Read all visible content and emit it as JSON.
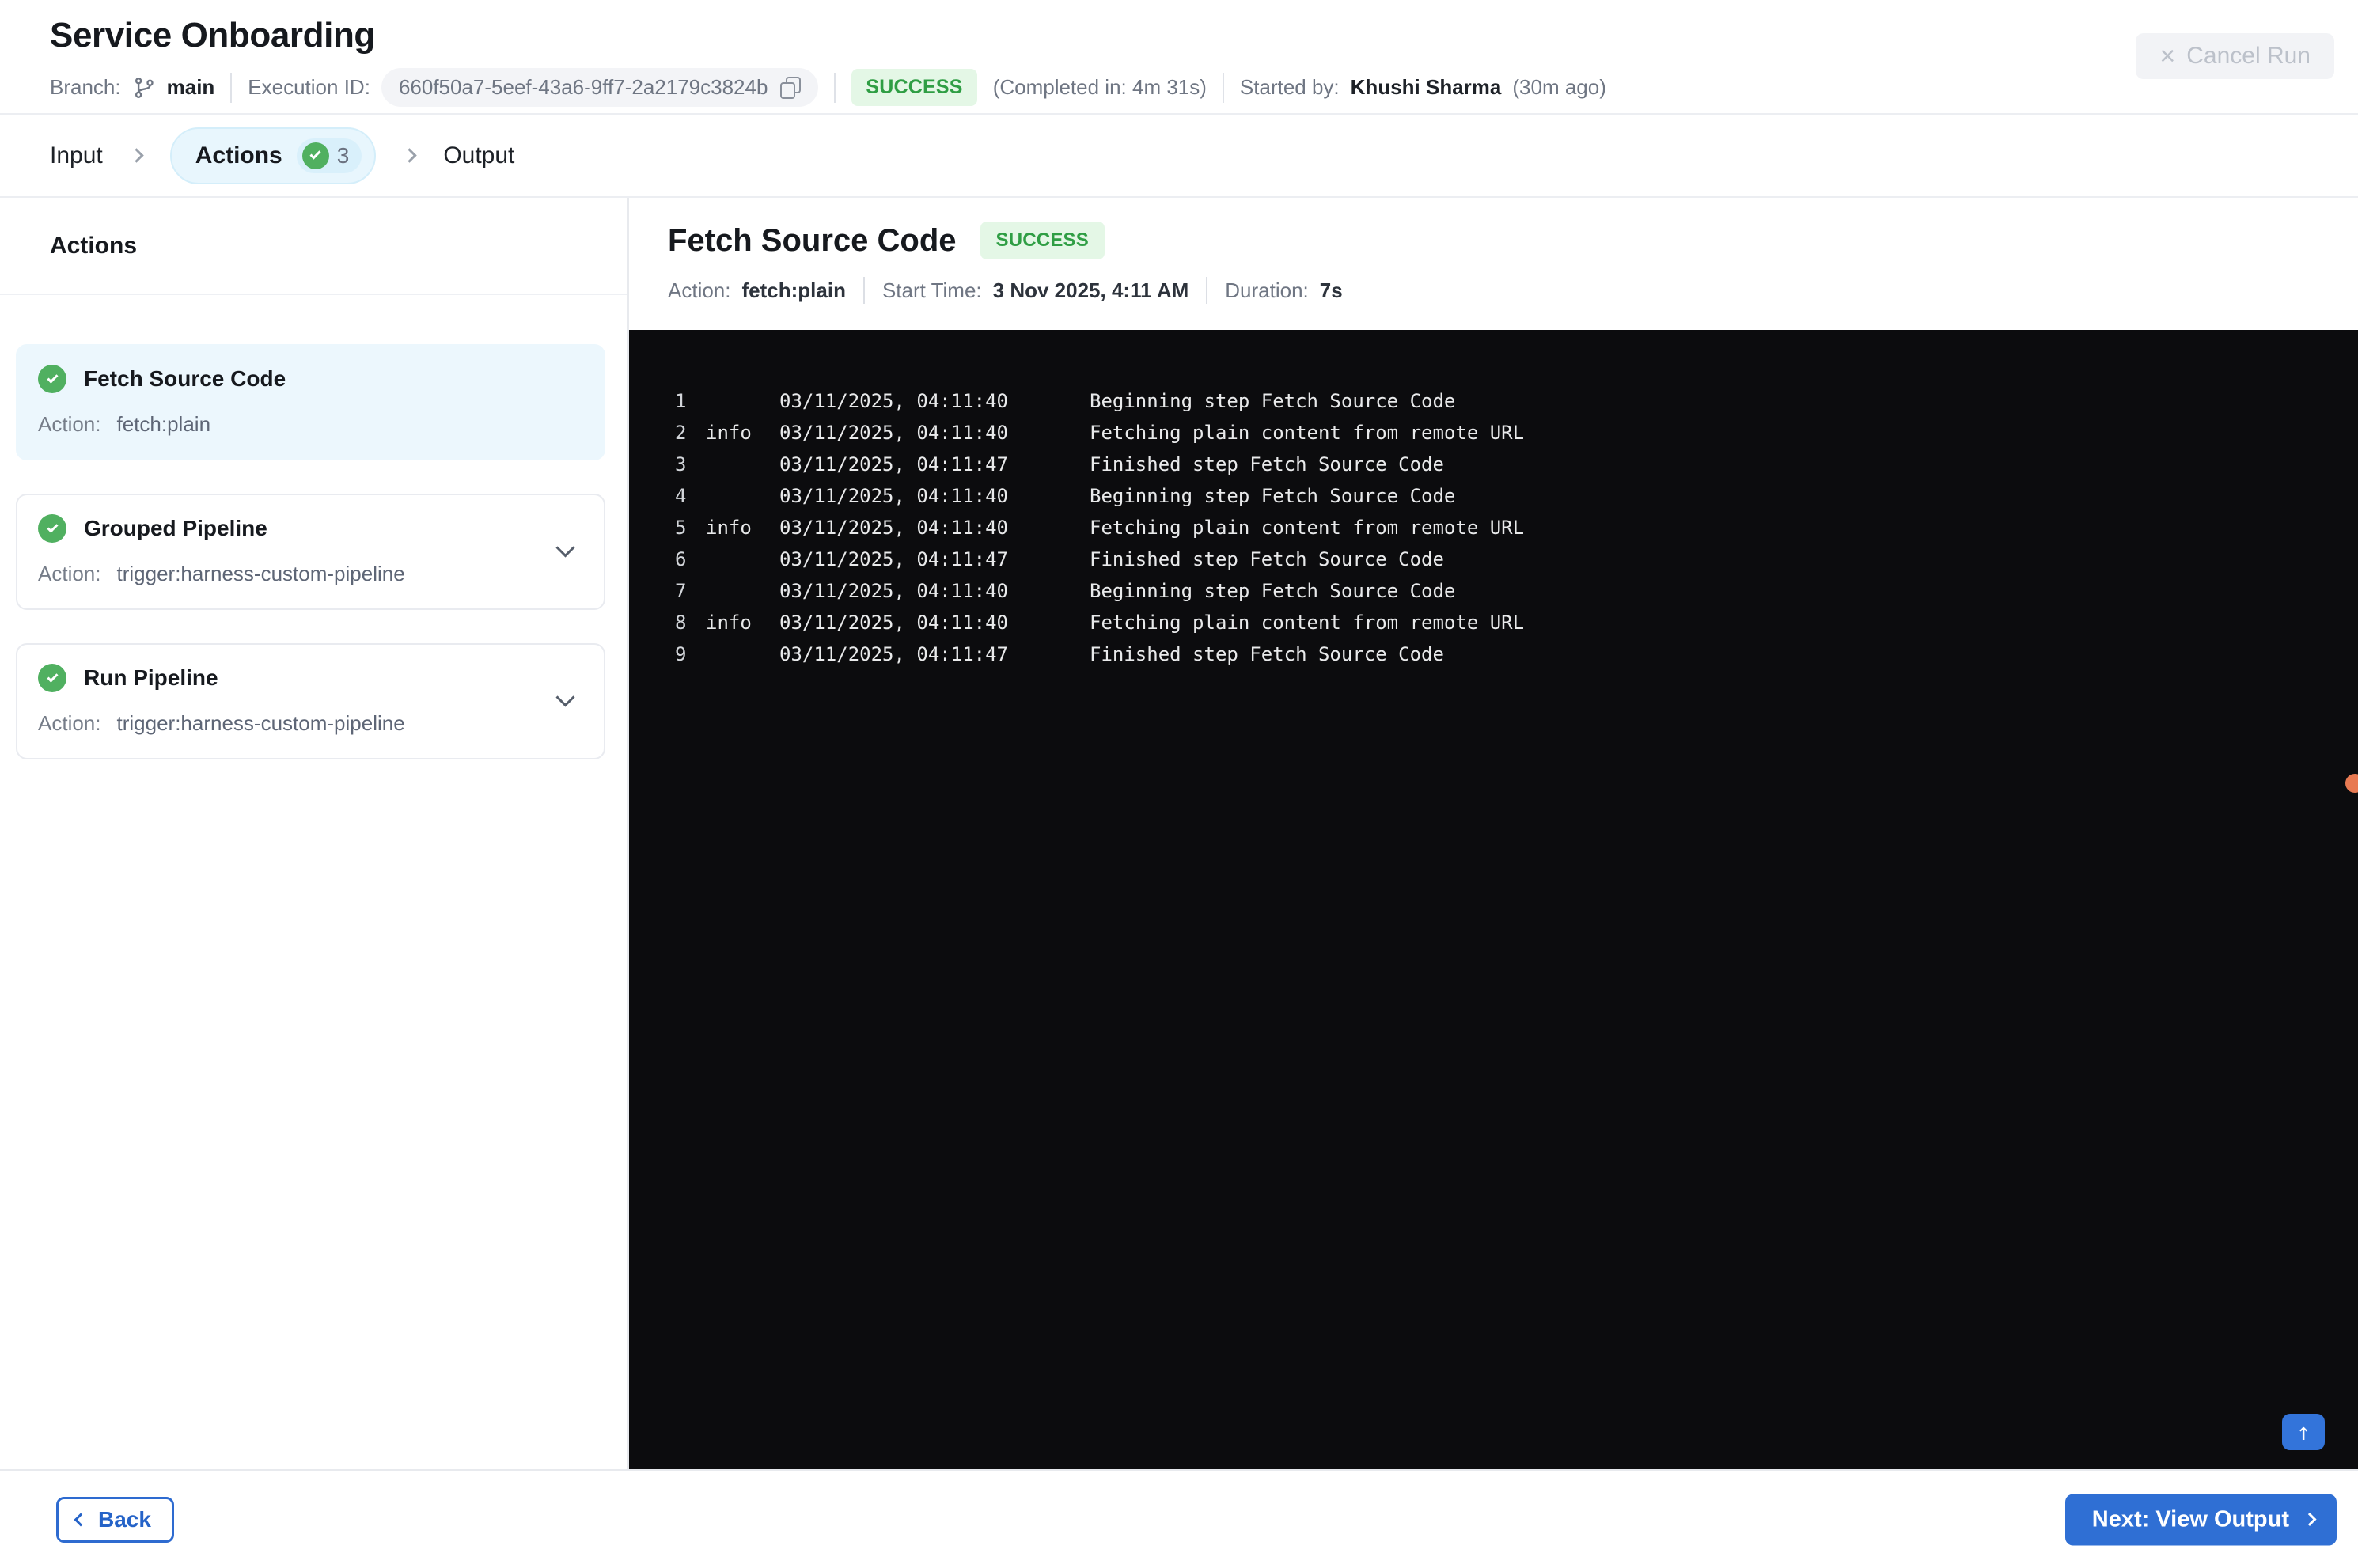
{
  "header": {
    "title": "Service Onboarding",
    "branch_label": "Branch:",
    "branch_name": "main",
    "execution_id_label": "Execution ID:",
    "execution_id": "660f50a7-5eef-43a6-9ff7-2a2179c3824b",
    "status": "SUCCESS",
    "completed_in": "(Completed in: 4m 31s)",
    "started_by_label": "Started by:",
    "started_by": "Khushi Sharma",
    "started_ago": "(30m ago)",
    "cancel_button": "Cancel Run"
  },
  "stepper": {
    "tabs": [
      {
        "label": "Input",
        "active": false
      },
      {
        "label": "Actions",
        "active": true,
        "badge_count": "3"
      },
      {
        "label": "Output",
        "active": false
      }
    ]
  },
  "sidebar": {
    "heading": "Actions",
    "action_label": "Action:",
    "items": [
      {
        "title": "Fetch Source Code",
        "action": "fetch:plain",
        "status": "success",
        "selected": true,
        "expandable": false
      },
      {
        "title": "Grouped Pipeline",
        "action": "trigger:harness-custom-pipeline",
        "status": "success",
        "selected": false,
        "expandable": true
      },
      {
        "title": "Run Pipeline",
        "action": "trigger:harness-custom-pipeline",
        "status": "success",
        "selected": false,
        "expandable": true
      }
    ]
  },
  "detail": {
    "title": "Fetch Source Code",
    "status": "SUCCESS",
    "meta": [
      {
        "label": "Action:",
        "value": "fetch:plain"
      },
      {
        "label": "Start Time:",
        "value": "3 Nov 2025, 4:11 AM"
      },
      {
        "label": "Duration:",
        "value": "7s"
      }
    ]
  },
  "console": {
    "lines": [
      {
        "n": "1",
        "level": "",
        "time": "03/11/2025, 04:11:40",
        "message": "Beginning step Fetch Source Code"
      },
      {
        "n": "2",
        "level": "info",
        "time": "03/11/2025, 04:11:40",
        "message": "Fetching plain content from remote URL"
      },
      {
        "n": "3",
        "level": "",
        "time": "03/11/2025, 04:11:47",
        "message": "Finished step Fetch Source Code"
      },
      {
        "n": "4",
        "level": "",
        "time": "03/11/2025, 04:11:40",
        "message": "Beginning step Fetch Source Code"
      },
      {
        "n": "5",
        "level": "info",
        "time": "03/11/2025, 04:11:40",
        "message": "Fetching plain content from remote URL"
      },
      {
        "n": "6",
        "level": "",
        "time": "03/11/2025, 04:11:47",
        "message": "Finished step Fetch Source Code"
      },
      {
        "n": "7",
        "level": "",
        "time": "03/11/2025, 04:11:40",
        "message": "Beginning step Fetch Source Code"
      },
      {
        "n": "8",
        "level": "info",
        "time": "03/11/2025, 04:11:40",
        "message": "Fetching plain content from remote URL"
      },
      {
        "n": "9",
        "level": "",
        "time": "03/11/2025, 04:11:47",
        "message": "Finished step Fetch Source Code"
      }
    ],
    "scroll_top_icon": "↑"
  },
  "footer": {
    "back_button": "Back",
    "next_button": "Next: View Output"
  },
  "colors": {
    "accent_blue": "#2f6fd4",
    "success_text": "#2f9e44",
    "success_badge_bg": "#e4f7e6",
    "check_circle_green": "#50b060",
    "active_tab_bg": "#e8f6fd",
    "selected_card_bg": "#ecf7fd",
    "console_bg": "#0c0c0e",
    "orange_dot": "#e87a52"
  }
}
